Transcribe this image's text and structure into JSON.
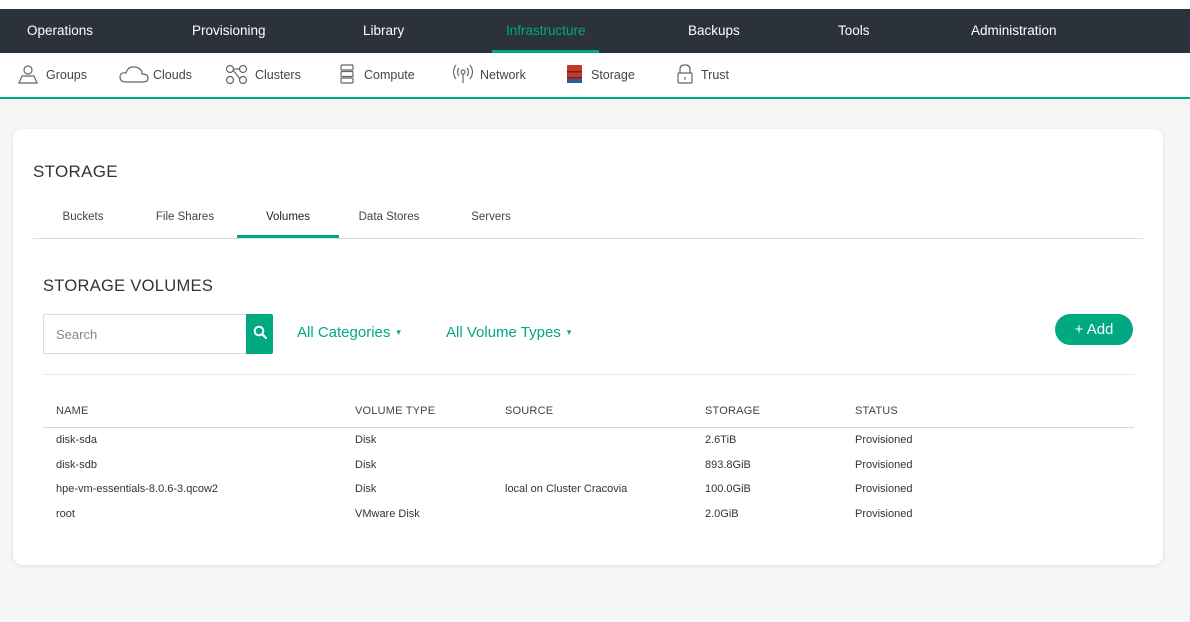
{
  "main_nav": {
    "items": [
      {
        "label": "Operations"
      },
      {
        "label": "Provisioning"
      },
      {
        "label": "Library"
      },
      {
        "label": "Infrastructure"
      },
      {
        "label": "Backups"
      },
      {
        "label": "Tools"
      },
      {
        "label": "Administration"
      }
    ],
    "active_index": 3
  },
  "sub_nav": {
    "items": [
      {
        "label": "Groups",
        "icon": "groups-icon"
      },
      {
        "label": "Clouds",
        "icon": "cloud-icon"
      },
      {
        "label": "Clusters",
        "icon": "clusters-icon"
      },
      {
        "label": "Compute",
        "icon": "compute-icon"
      },
      {
        "label": "Network",
        "icon": "network-icon"
      },
      {
        "label": "Storage",
        "icon": "storage-icon"
      },
      {
        "label": "Trust",
        "icon": "lock-icon"
      }
    ],
    "active_label": "Storage"
  },
  "page": {
    "title": "STORAGE",
    "tabs": [
      {
        "label": "Buckets"
      },
      {
        "label": "File Shares"
      },
      {
        "label": "Volumes"
      },
      {
        "label": "Data Stores"
      },
      {
        "label": "Servers"
      }
    ],
    "active_tab": "Volumes"
  },
  "volumes": {
    "title": "STORAGE VOLUMES",
    "search": {
      "placeholder": "Search",
      "value": ""
    },
    "filters": {
      "categories": "All Categories",
      "volume_types": "All Volume Types"
    },
    "add_label": "+ Add",
    "columns": [
      "NAME",
      "VOLUME TYPE",
      "SOURCE",
      "STORAGE",
      "STATUS"
    ],
    "rows": [
      {
        "name": "disk-sda",
        "type": "Disk",
        "source": "",
        "storage": "2.6TiB",
        "status": "Provisioned"
      },
      {
        "name": "disk-sdb",
        "type": "Disk",
        "source": "",
        "storage": "893.8GiB",
        "status": "Provisioned"
      },
      {
        "name": "hpe-vm-essentials-8.0.6-3.qcow2",
        "type": "Disk",
        "source": "local on Cluster Cracovia",
        "storage": "100.0GiB",
        "status": "Provisioned"
      },
      {
        "name": "root",
        "type": "VMware Disk",
        "source": "",
        "storage": "2.0GiB",
        "status": "Provisioned"
      }
    ]
  },
  "colors": {
    "accent": "#01a982",
    "nav_bg": "#2b323b",
    "page_bg": "#f6f6f6"
  }
}
